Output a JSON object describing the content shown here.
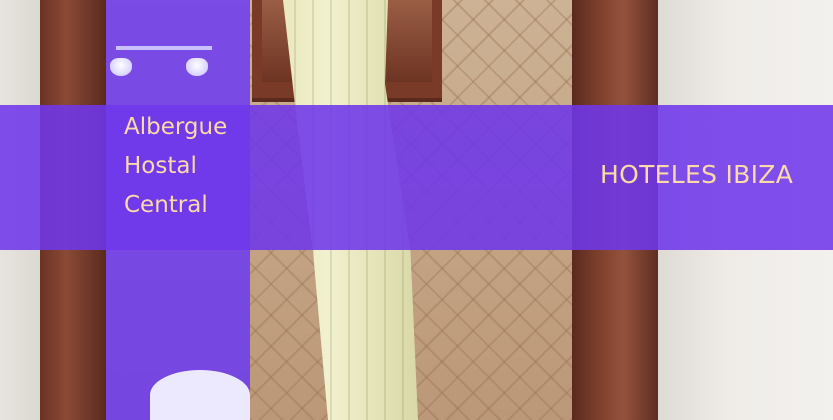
{
  "banner": {
    "title_lines": [
      "Albergue",
      "Hostal",
      "Central"
    ],
    "brand": "HOTELES IBIZA"
  },
  "colors": {
    "overlay_purple": "#6e37eb",
    "text_peach": "#fbd9a8",
    "door_wood": "#7c3f2c"
  }
}
